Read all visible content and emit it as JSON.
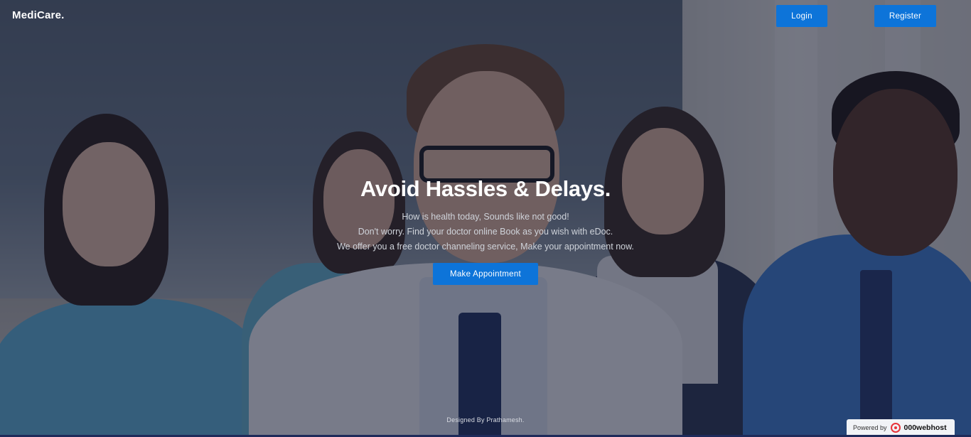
{
  "header": {
    "brand": "MediCare.",
    "login_label": "Login",
    "register_label": "Register"
  },
  "hero": {
    "title": "Avoid Hassles & Delays.",
    "lines": [
      "How is health today, Sounds like not good!",
      "Don't worry. Find your doctor online Book as you wish with eDoc.",
      "We offer you a free doctor channeling service, Make your appointment now."
    ],
    "cta_label": "Make Appointment"
  },
  "footer": {
    "credit": "Designed By Prathamesh."
  },
  "powered_badge": {
    "prefix": "Powered by",
    "brand": "000webhost",
    "icon": "webhost-logo-icon"
  },
  "colors": {
    "accent": "#0d74d9",
    "overlay": "#121830",
    "badge_red": "#e8343a"
  }
}
